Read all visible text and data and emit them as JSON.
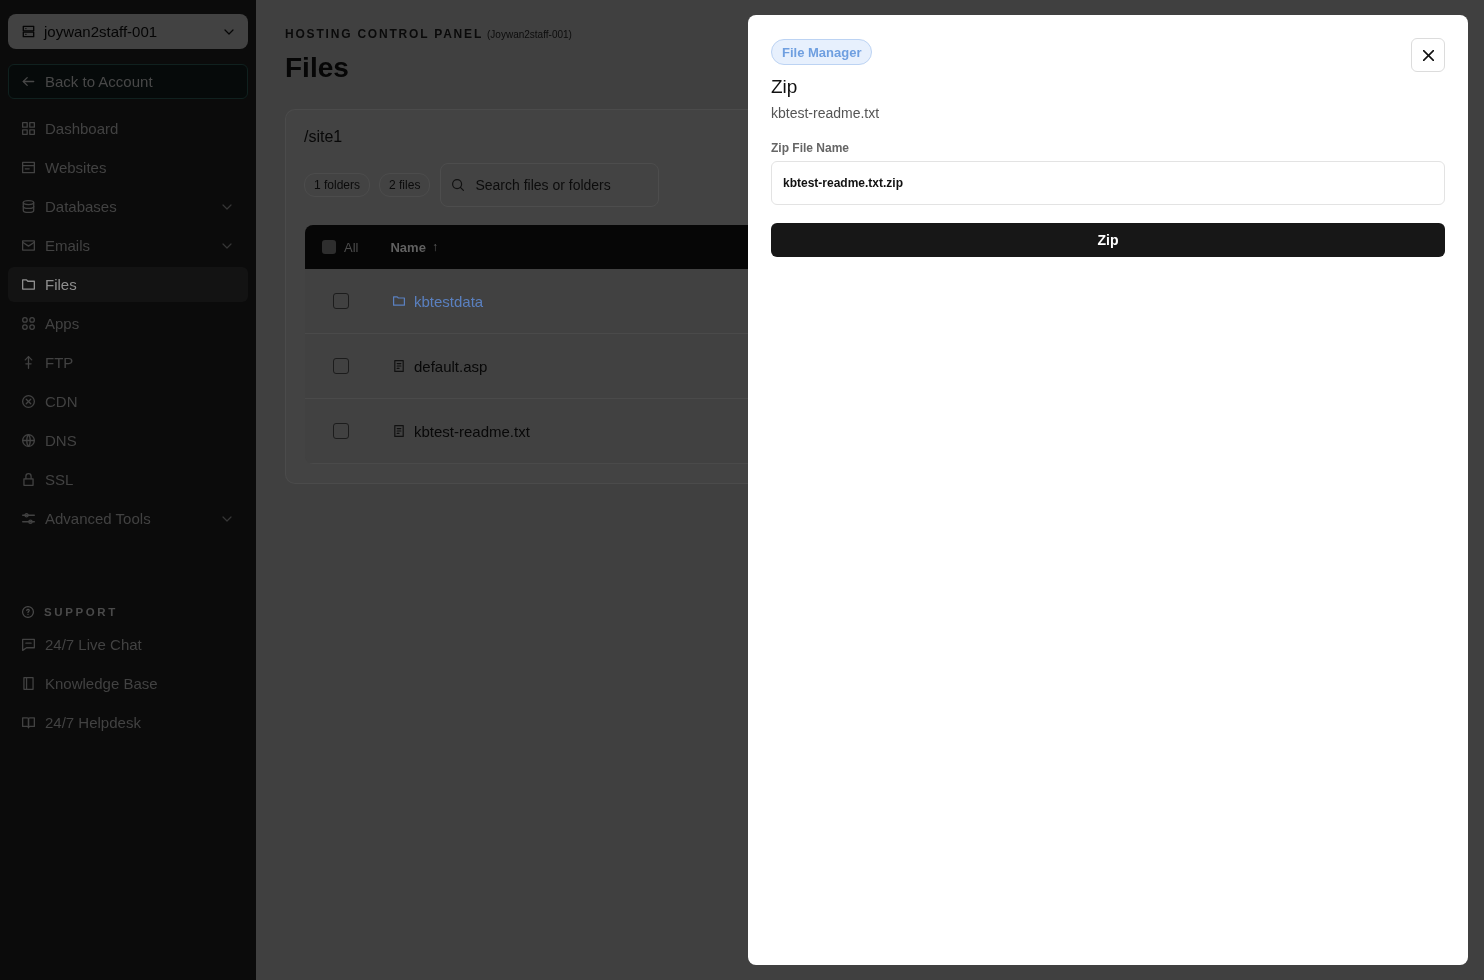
{
  "sidebar": {
    "account": {
      "label": "joywan2staff-001"
    },
    "back_link": {
      "label": "Back to Account"
    },
    "nav_items": [
      {
        "label": "Dashboard",
        "selected": false,
        "has_submenu": false
      },
      {
        "label": "Websites",
        "selected": false,
        "has_submenu": false
      },
      {
        "label": "Databases",
        "selected": false,
        "has_submenu": true
      },
      {
        "label": "Emails",
        "selected": false,
        "has_submenu": true
      },
      {
        "label": "Files",
        "selected": true,
        "has_submenu": false
      },
      {
        "label": "Apps",
        "selected": false,
        "has_submenu": false
      },
      {
        "label": "FTP",
        "selected": false,
        "has_submenu": false
      },
      {
        "label": "CDN",
        "selected": false,
        "has_submenu": false
      },
      {
        "label": "DNS",
        "selected": false,
        "has_submenu": false
      },
      {
        "label": "SSL",
        "selected": false,
        "has_submenu": false
      },
      {
        "label": "Advanced Tools",
        "selected": false,
        "has_submenu": true
      }
    ],
    "support": {
      "heading": "SUPPORT",
      "items": [
        {
          "label": "24/7 Live Chat"
        },
        {
          "label": "Knowledge Base"
        },
        {
          "label": "24/7 Helpdesk"
        }
      ]
    }
  },
  "header": {
    "eyebrow": "HOSTING CONTROL PANEL",
    "account_note": "(Joywan2staff-001)",
    "title": "Files"
  },
  "file_browser": {
    "path": "/site1",
    "counts": [
      "1 folders",
      "2 files"
    ],
    "search": {
      "placeholder": "Search files or folders"
    },
    "table": {
      "select_all": {
        "label": "All",
        "checked": false
      },
      "columns": [
        {
          "label": "Name",
          "sort_mark": "↑"
        }
      ],
      "rows": [
        {
          "kind": "folder",
          "name": "kbtestdata",
          "checked": false
        },
        {
          "kind": "file",
          "name": "default.asp",
          "checked": false
        },
        {
          "kind": "file",
          "name": "kbtest-readme.txt",
          "checked": false
        }
      ]
    }
  },
  "modal": {
    "badge": "File Manager",
    "title": "Zip",
    "subtitle": "kbtest-readme.txt",
    "field": {
      "label": "Zip File Name",
      "value": "kbtest-readme.txt.zip"
    },
    "submit_label": "Zip"
  }
}
